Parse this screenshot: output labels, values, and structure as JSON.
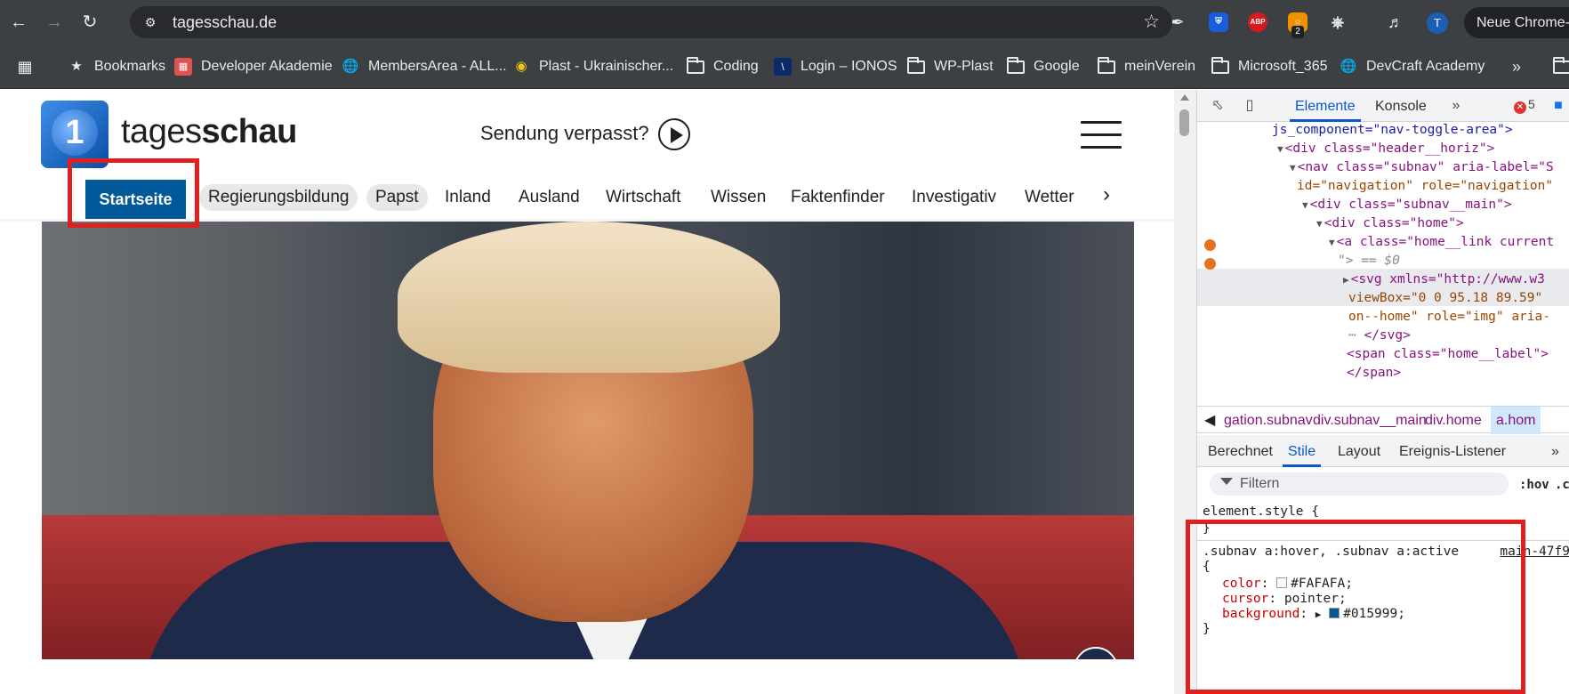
{
  "browser": {
    "url": "tagesschau.de",
    "profile_label": "Neue Chrome-V",
    "avatar_letter": "T",
    "extension_badge": "2",
    "abp_label": "ABP",
    "bookmarks": [
      {
        "label": "Bookmarks",
        "icon": "star-icon"
      },
      {
        "label": "Developer Akademie",
        "icon": "site-icon"
      },
      {
        "label": "MembersArea - ALL...",
        "icon": "globe-icon"
      },
      {
        "label": "Plast - Ukrainischer...",
        "icon": "site-icon"
      },
      {
        "label": "Coding",
        "icon": "folder-icon"
      },
      {
        "label": "Login – IONOS",
        "icon": "site-icon"
      },
      {
        "label": "WP-Plast",
        "icon": "folder-icon"
      },
      {
        "label": "Google",
        "icon": "folder-icon"
      },
      {
        "label": "meinVerein",
        "icon": "folder-icon"
      },
      {
        "label": "Microsoft_365",
        "icon": "folder-icon"
      },
      {
        "label": "DevCraft Academy",
        "icon": "globe-icon"
      }
    ]
  },
  "site": {
    "logo_digit": "1",
    "wordmark_light": "tages",
    "wordmark_bold": "schau",
    "missed_label": "Sendung verpasst?",
    "nav": {
      "home": "Startseite",
      "items": [
        "Regierungsbildung",
        "Papst",
        "Inland",
        "Ausland",
        "Wirtschaft",
        "Wissen",
        "Faktenfinder",
        "Investigativ",
        "Wetter"
      ]
    }
  },
  "devtools": {
    "tabs": {
      "elements": "Elemente",
      "console": "Konsole"
    },
    "error_count": "5",
    "dom_lines": [
      {
        "text": "js_component=\"nav-toggle-area\">"
      },
      {
        "text": "<div class=\"header__horiz\">"
      },
      {
        "text": "<nav class=\"subnav\" aria-label=\"S"
      },
      {
        "text": "id=\"navigation\" role=\"navigation\""
      },
      {
        "text": "<div class=\"subnav__main\">"
      },
      {
        "text": "<div class=\"home\">"
      },
      {
        "text": "<a class=\"home__link current"
      },
      {
        "text": "\"> == $0"
      },
      {
        "text": "<svg xmlns=\"http://www.w3"
      },
      {
        "text": "viewBox=\"0 0 95.18 89.59\""
      },
      {
        "text": "on--home\" role=\"img\" aria-"
      },
      {
        "text": "</svg>"
      },
      {
        "text": "<span class=\"home__label\">"
      },
      {
        "text": "</span>"
      }
    ],
    "breadcrumbs": [
      "gation.subnav",
      "div.subnav__main",
      "div.home",
      "a.hom"
    ],
    "styles_tabs": {
      "computed": "Berechnet",
      "styles": "Stile",
      "layout": "Layout",
      "listeners": "Ereignis-Listener"
    },
    "filter_placeholder": "Filtern",
    "filter_hov": ":hov",
    "filter_cls": ".cl",
    "element_style_open": "element.style {",
    "close_brace": "}",
    "rule_selector": ".subnav a:hover, .subnav a:active",
    "rule_source": "main-47f9",
    "rule_open": "{",
    "props": [
      {
        "name": "color",
        "value": "#FAFAFA",
        "swatch": "#fafafa"
      },
      {
        "name": "cursor",
        "value": "pointer"
      },
      {
        "name": "background",
        "value": "#015999",
        "swatch": "#015999"
      }
    ]
  },
  "colors": {
    "accent": "#015999",
    "annotation": "#e02020"
  }
}
